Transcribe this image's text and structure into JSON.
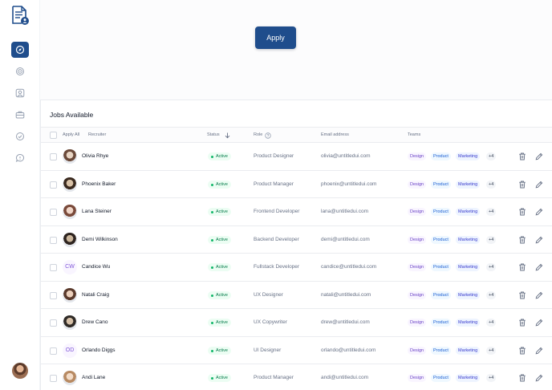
{
  "sidebar": {
    "logo_icon": "document-user-icon",
    "items": [
      {
        "icon": "compass-icon",
        "active": true
      },
      {
        "icon": "target-icon",
        "active": false
      },
      {
        "icon": "user-square-icon",
        "active": false
      },
      {
        "icon": "briefcase-icon",
        "active": false
      },
      {
        "icon": "check-circle-icon",
        "active": false
      },
      {
        "icon": "message-icon",
        "active": false
      }
    ],
    "user_avatar": "user-avatar"
  },
  "apply_button": "Apply",
  "jobs": {
    "title": "Jobs Available",
    "columns": {
      "apply_all": "Apply All",
      "recruiter": "Recruiter",
      "status": "Status",
      "role": "Role",
      "email": "Email address",
      "teams": "Teams"
    },
    "rows": [
      {
        "name": "Olivia Rhye",
        "initials": "",
        "status": "Active",
        "role": "Product Designer",
        "email": "olivia@untitledui.com",
        "teams": [
          "Design",
          "Product",
          "Marketing",
          "+4"
        ]
      },
      {
        "name": "Phoenix Baker",
        "initials": "",
        "status": "Active",
        "role": "Product Manager",
        "email": "phoenix@untitledui.com",
        "teams": [
          "Design",
          "Product",
          "Marketing",
          "+4"
        ]
      },
      {
        "name": "Lana Steiner",
        "initials": "",
        "status": "Active",
        "role": "Frontend Developer",
        "email": "lana@untitledui.com",
        "teams": [
          "Design",
          "Product",
          "Marketing",
          "+4"
        ]
      },
      {
        "name": "Demi Wilkinson",
        "initials": "",
        "status": "Active",
        "role": "Backend Developer",
        "email": "demi@untitledui.com",
        "teams": [
          "Design",
          "Product",
          "Marketing",
          "+4"
        ]
      },
      {
        "name": "Candice Wu",
        "initials": "CW",
        "status": "Active",
        "role": "Fullstack Developer",
        "email": "candice@untitledui.com",
        "teams": [
          "Design",
          "Product",
          "Marketing",
          "+4"
        ]
      },
      {
        "name": "Natali Craig",
        "initials": "",
        "status": "Active",
        "role": "UX Designer",
        "email": "natali@untitledui.com",
        "teams": [
          "Design",
          "Product",
          "Marketing",
          "+4"
        ]
      },
      {
        "name": "Drew Cano",
        "initials": "",
        "status": "Active",
        "role": "UX Copywriter",
        "email": "drew@untitledui.com",
        "teams": [
          "Design",
          "Product",
          "Marketing",
          "+4"
        ]
      },
      {
        "name": "Orlando Diggs",
        "initials": "OD",
        "status": "Active",
        "role": "UI Designer",
        "email": "orlando@untitledui.com",
        "teams": [
          "Design",
          "Product",
          "Marketing",
          "+4"
        ]
      },
      {
        "name": "Andi Lane",
        "initials": "",
        "status": "Active",
        "role": "Product Manager",
        "email": "andi@untitledui.com",
        "teams": [
          "Design",
          "Product",
          "Marketing",
          "+4"
        ]
      }
    ]
  },
  "colors": {
    "primary": "#1f4d8c",
    "active_badge_bg": "#ecfdf3",
    "active_badge_text": "#027a48"
  }
}
